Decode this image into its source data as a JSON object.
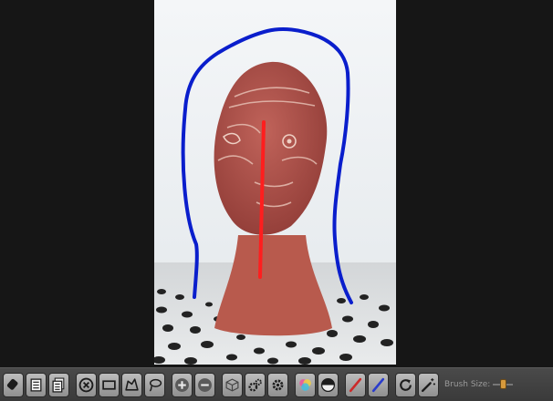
{
  "toolbar": {
    "buttons": [
      {
        "name": "eraser-icon"
      },
      {
        "name": "document-icon"
      },
      {
        "name": "documents-icon"
      },
      {
        "name": "cancel-circle-icon"
      },
      {
        "name": "rectangle-select-icon"
      },
      {
        "name": "polygon-select-icon"
      },
      {
        "name": "lasso-select-icon"
      },
      {
        "name": "zoom-in-icon"
      },
      {
        "name": "zoom-out-icon"
      },
      {
        "name": "cube-icon"
      },
      {
        "name": "gears-icon"
      },
      {
        "name": "gear-icon"
      },
      {
        "name": "color-wheel-icon"
      },
      {
        "name": "half-circle-icon"
      },
      {
        "name": "red-brush-icon"
      },
      {
        "name": "blue-brush-icon"
      },
      {
        "name": "refresh-icon"
      },
      {
        "name": "magic-wand-icon"
      }
    ],
    "brush_size_label": "Brush Size:",
    "brush_size_level": 0.5
  },
  "colors": {
    "foreground_stroke": "#0a1ecc",
    "background_stroke": "#ff1e1e",
    "toolbar_bg": "#3f3f3f",
    "viewport_bg": "#161616"
  }
}
